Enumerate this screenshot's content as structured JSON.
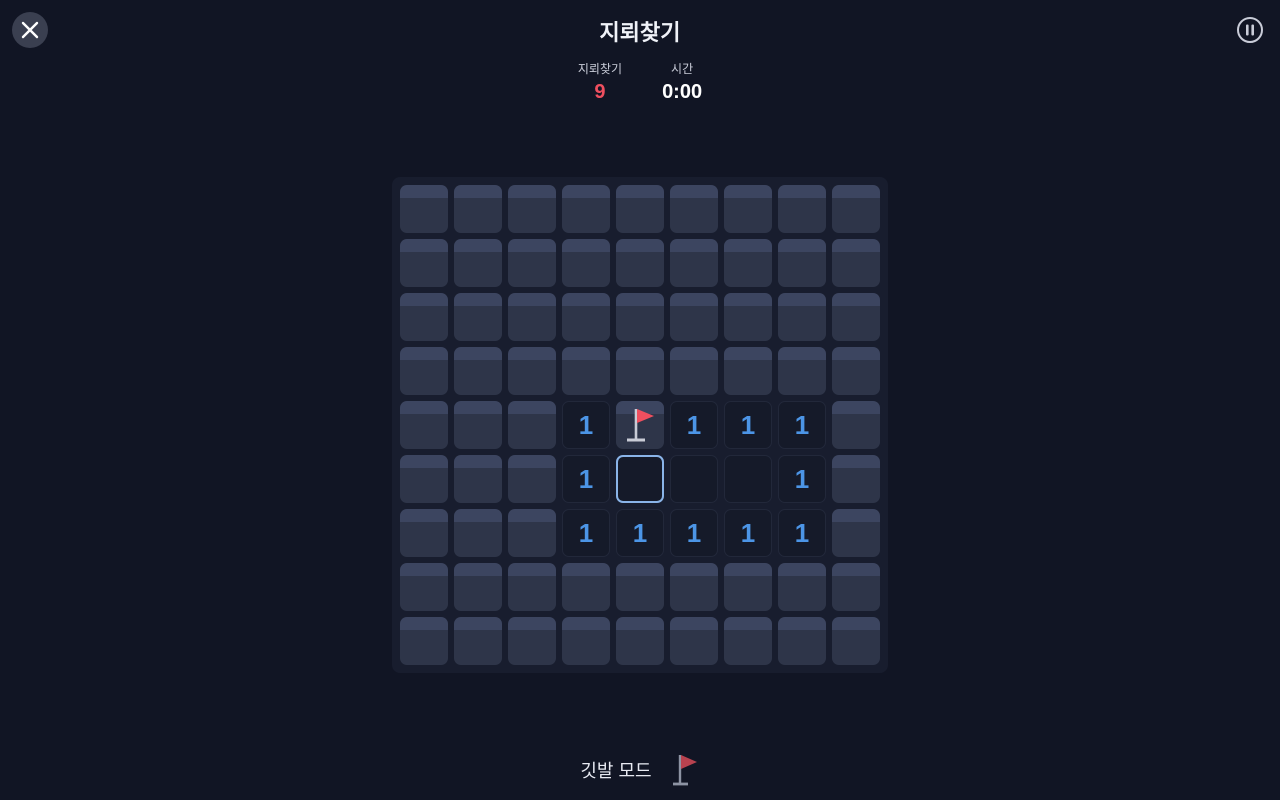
{
  "header": {
    "title": "지뢰찾기"
  },
  "stats": {
    "mines_label": "지뢰찾기",
    "mines_value": "9",
    "time_label": "시간",
    "time_value": "0:00"
  },
  "board": {
    "rows": 9,
    "cols": 9,
    "selected": [
      5,
      4
    ],
    "grid": [
      [
        "h",
        "h",
        "h",
        "h",
        "h",
        "h",
        "h",
        "h",
        "h"
      ],
      [
        "h",
        "h",
        "h",
        "h",
        "h",
        "h",
        "h",
        "h",
        "h"
      ],
      [
        "h",
        "h",
        "h",
        "h",
        "h",
        "h",
        "h",
        "h",
        "h"
      ],
      [
        "h",
        "h",
        "h",
        "h",
        "h",
        "h",
        "h",
        "h",
        "h"
      ],
      [
        "h",
        "h",
        "h",
        "1",
        "F",
        "1",
        "1",
        "1",
        "h"
      ],
      [
        "h",
        "h",
        "h",
        "1",
        "0",
        "0",
        "0",
        "1",
        "h"
      ],
      [
        "h",
        "h",
        "h",
        "1",
        "1",
        "1",
        "1",
        "1",
        "h"
      ],
      [
        "h",
        "h",
        "h",
        "h",
        "h",
        "h",
        "h",
        "h",
        "h"
      ],
      [
        "h",
        "h",
        "h",
        "h",
        "h",
        "h",
        "h",
        "h",
        "h"
      ]
    ]
  },
  "footer": {
    "flag_mode_label": "깃발 모드"
  },
  "colors": {
    "background": "#111524",
    "mine_count": "#ef4f5f",
    "number": "#4c95e6",
    "flag": "#ef4f5f",
    "selection": "#8ab4e8"
  },
  "icons": {
    "close": "close-icon",
    "pause": "pause-icon",
    "flag": "flag-icon"
  }
}
